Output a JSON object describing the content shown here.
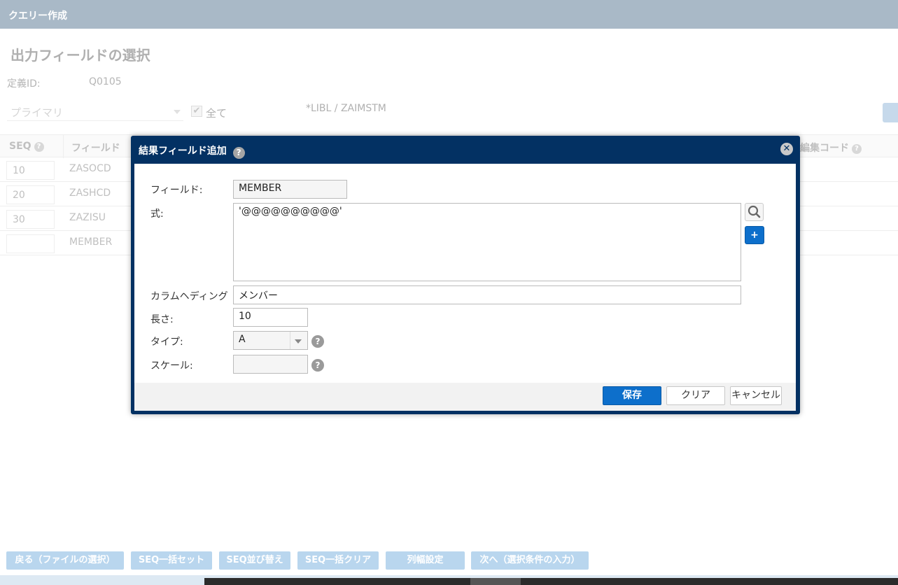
{
  "app": {
    "title": "クエリー作成"
  },
  "page": {
    "heading": "出力フィールドの選択",
    "definition_id_label": "定義ID:",
    "definition_id_value": "Q0105",
    "primary_select": "プライマリ",
    "all_label": "全て",
    "all_checked": true,
    "library_path": "*LIBL / ZAIMSTM"
  },
  "table": {
    "headers": {
      "seq": "SEQ",
      "field": "フィールド",
      "edit_code": "編集コード"
    },
    "rows": [
      {
        "seq": "10",
        "field": "ZASOCD"
      },
      {
        "seq": "20",
        "field": "ZASHCD"
      },
      {
        "seq": "30",
        "field": "ZAZISU"
      },
      {
        "seq": "",
        "field": "MEMBER"
      }
    ]
  },
  "modal": {
    "title": "結果フィールド追加",
    "field_label": "フィールド:",
    "field_value": "MEMBER",
    "expr_label": "式:",
    "expr_value": "'@@@@@@@@@@'",
    "heading_label": "カラムヘディング",
    "heading_value": "メンバー",
    "length_label": "長さ:",
    "length_value": "10",
    "type_label": "タイプ:",
    "type_value": "A",
    "scale_label": "スケール:",
    "scale_value": "",
    "plus_label": "+",
    "help_glyph": "?",
    "close_glyph": "✕",
    "buttons": {
      "save": "保存",
      "clear": "クリア",
      "cancel": "キャンセル"
    }
  },
  "bottom_buttons": {
    "back": "戻る（ファイルの選択）",
    "seq_set": "SEQ一括セット",
    "seq_sort": "SEQ並び替え",
    "seq_clear": "SEQ一括クリア",
    "col_width": "列幅設定",
    "next": "次へ（選択条件の入力）"
  },
  "colors": {
    "topbar": "#a9b9c7",
    "modal_header": "#033163",
    "primary_button": "#0d6fcb",
    "bottom_button": "#b9d6ee"
  }
}
